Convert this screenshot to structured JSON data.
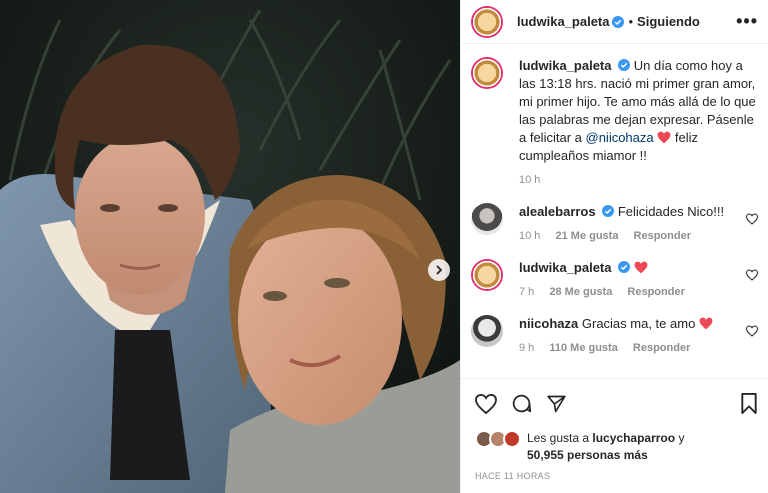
{
  "post": {
    "username": "ludwika_paleta",
    "follow_status": "Siguiendo",
    "more_label": "•••"
  },
  "caption": {
    "username": "ludwika_paleta",
    "text_part1": "Un día como hoy a las 13:18 hrs. nació mi primer gran amor, mi primer hijo. Te amo más allá de lo que las palabras me dejan expresar. Pásenle a felicitar a",
    "mention": "@niicohaza",
    "text_part2": "feliz cumpleaños miamor !!",
    "time": "10 h"
  },
  "comments": [
    {
      "username": "alealebarros",
      "text": "Felicidades Nico!!!",
      "time": "10 h",
      "likes": "21 Me gusta",
      "reply": "Responder"
    },
    {
      "username": "ludwika_paleta",
      "text": "",
      "time": "7 h",
      "likes": "28 Me gusta",
      "reply": "Responder"
    },
    {
      "username": "niicohaza",
      "text": "Gracias ma, te amo",
      "time": "9 h",
      "likes": "110 Me gusta",
      "reply": "Responder"
    }
  ],
  "likes": {
    "prefix": "Les gusta a",
    "user": "lucychaparroo",
    "suffix": "y",
    "count": "50,955 personas más"
  },
  "timestamp": "HACE 11 HORAS",
  "colors": {
    "heart": "#ed4956",
    "verified": "#3897f0",
    "meta": "#8e8e8e"
  },
  "icons": [
    "verified-icon",
    "heart-icon",
    "comment-icon",
    "share-icon",
    "bookmark-icon",
    "chevron-right-icon"
  ]
}
